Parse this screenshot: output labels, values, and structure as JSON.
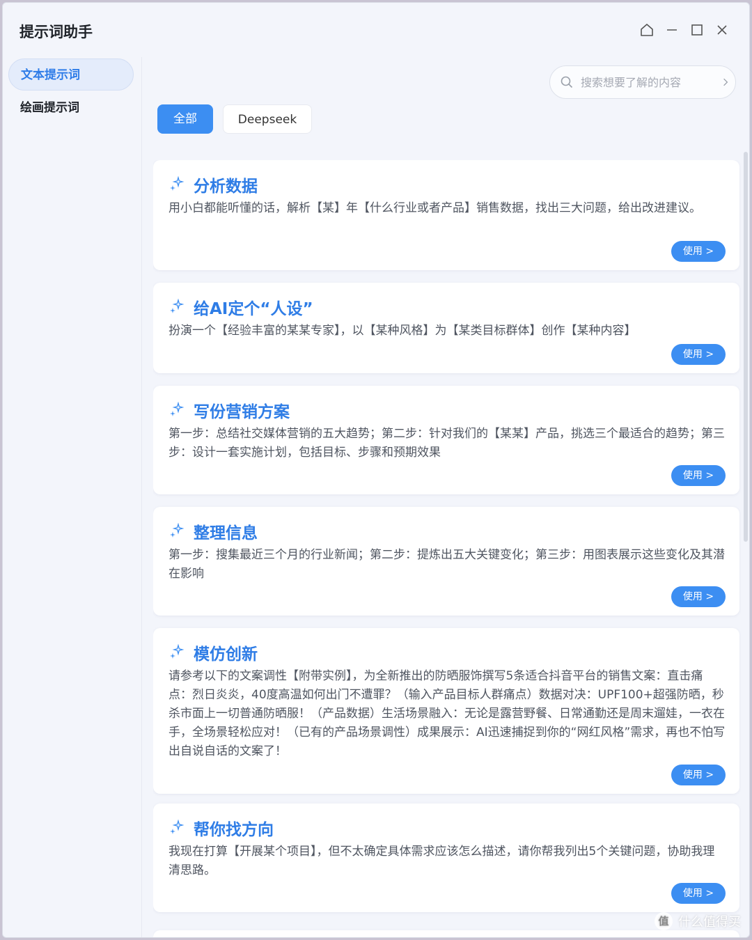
{
  "app": {
    "title": "提示词助手"
  },
  "sidebar": {
    "items": [
      {
        "label": "文本提示词",
        "active": true
      },
      {
        "label": "绘画提示词",
        "active": false
      }
    ]
  },
  "search": {
    "placeholder": "搜索想要了解的内容"
  },
  "filters": [
    {
      "label": "全部",
      "active": true
    },
    {
      "label": "Deepseek",
      "active": false
    }
  ],
  "cards": [
    {
      "title": "分析数据",
      "description": "用小白都能听懂的话，解析【某】年【什么行业或者产品】销售数据，找出三大问题，给出改进建议。",
      "button": "使用 >"
    },
    {
      "title": "给AI定个“人设”",
      "description": "扮演一个【经验丰富的某某专家】，以【某种风格】为【某类目标群体】创作【某种内容】",
      "button": "使用 >"
    },
    {
      "title": "写份营销方案",
      "description": "第一步：总结社交媒体营销的五大趋势；第二步：针对我们的【某某】产品，挑选三个最适合的趋势；第三步：设计一套实施计划，包括目标、步骤和预期效果",
      "button": "使用 >"
    },
    {
      "title": "整理信息",
      "description": "第一步：搜集最近三个月的行业新闻；第二步：提炼出五大关键变化；第三步：用图表展示这些变化及其潜在影响",
      "button": "使用 >"
    },
    {
      "title": "模仿创新",
      "description": "请参考以下的文案调性【附带实例】，为全新推出的防晒服饰撰写5条适合抖音平台的销售文案：直击痛点：烈日炎炎，40度高温如何出门不遭罪？（输入产品目标人群痛点）数据对决：UPF100+超强防晒，秒杀市面上一切普通防晒服！（产品数据）生活场景融入：无论是露营野餐、日常通勤还是周末遛娃，一衣在手，全场景轻松应对！（已有的产品场景调性）成果展示：AI迅速捕捉到你的“网红风格”需求，再也不怕写出自说自话的文案了！",
      "button": "使用 >"
    },
    {
      "title": "帮你找方向",
      "description": "我现在打算【开展某个项目】，但不太确定具体需求应该怎么描述，请你帮我列出5个关键问题，协助我理清思路。",
      "button": "使用 >"
    }
  ],
  "watermark": {
    "logo_text": "值",
    "text": "什么值得买"
  },
  "colors": {
    "accent": "#3c8ef2",
    "title_blue": "#2f7de6",
    "background": "#f3f5fb"
  },
  "icons": {
    "card": "sparkle-icon",
    "search": "search-icon",
    "home": "home-icon"
  }
}
